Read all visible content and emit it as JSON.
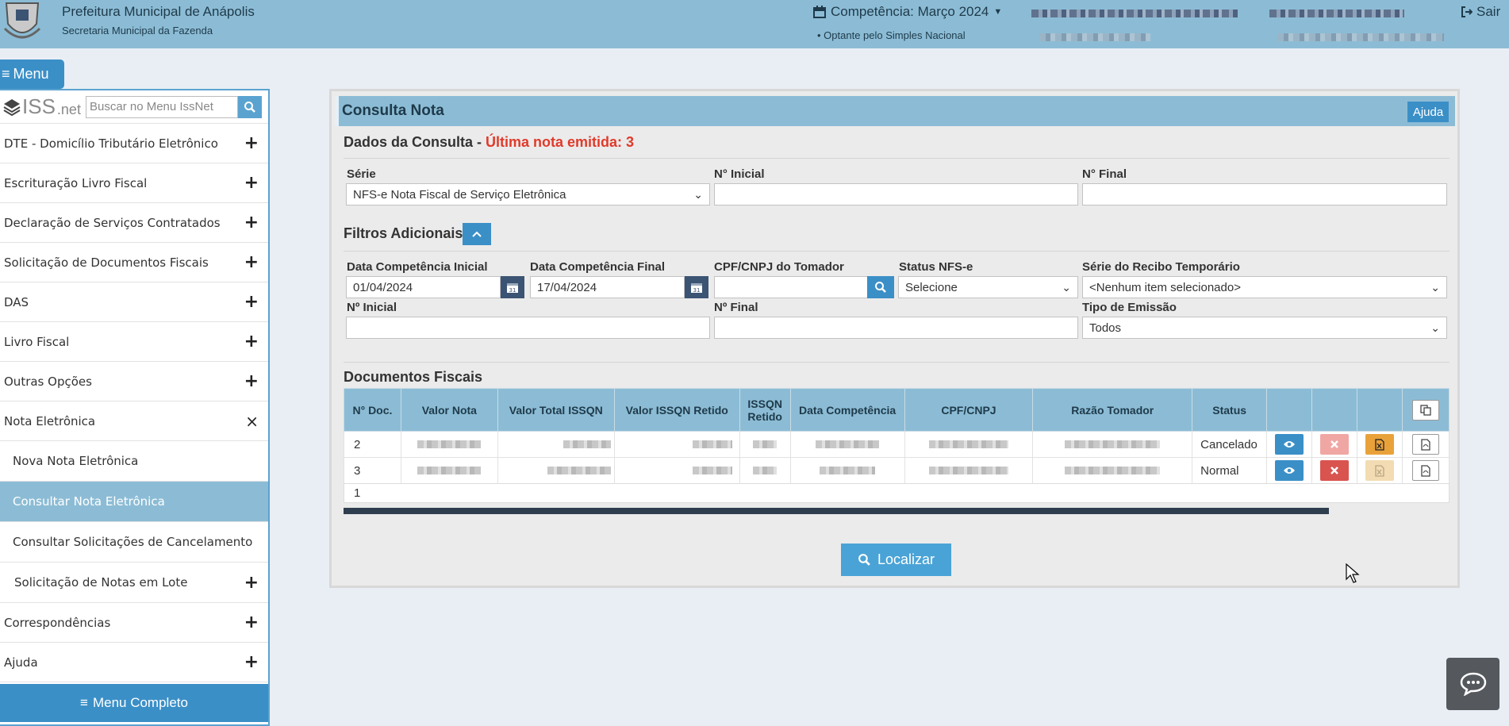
{
  "header": {
    "org_title": "Prefeitura Municipal de Anápolis",
    "org_subtitle": "Secretaria Municipal da Fazenda",
    "competencia": "Competência: Março 2024",
    "optante": "• Optante pelo Simples Nacional",
    "sair": "Sair"
  },
  "menu_button": "Menu",
  "sidebar": {
    "logo_text": "ISS",
    "logo_suffix": ".net",
    "search_placeholder": "Buscar no Menu IssNet",
    "items": [
      {
        "label": "DTE - Domicílio Tributário Eletrônico",
        "toggle": "+"
      },
      {
        "label": "Escrituração Livro Fiscal",
        "toggle": "+"
      },
      {
        "label": "Declaração de Serviços Contratados",
        "toggle": "+"
      },
      {
        "label": "Solicitação de Documentos Fiscais",
        "toggle": "+"
      },
      {
        "label": "DAS",
        "toggle": "+"
      },
      {
        "label": "Livro Fiscal",
        "toggle": "+"
      },
      {
        "label": "Outras Opções",
        "toggle": "+"
      },
      {
        "label": "Nota Eletrônica",
        "toggle": "×"
      },
      {
        "label": "Correspondências",
        "toggle": "+"
      },
      {
        "label": "Ajuda",
        "toggle": "+"
      }
    ],
    "subitems": [
      {
        "label": "Nova Nota Eletrônica"
      },
      {
        "label": "Consultar Nota Eletrônica"
      },
      {
        "label": "Consultar Solicitações de Cancelamento"
      },
      {
        "label": "Solicitação de Notas em Lote",
        "toggle": "+"
      }
    ],
    "menu_completo": "Menu Completo"
  },
  "panel": {
    "title": "Consulta Nota",
    "ajuda": "Ajuda",
    "dados_title": "Dados da Consulta -",
    "ultima_nota": "Última nota emitida: 3",
    "serie_label": "Série",
    "serie_value": "NFS-e Nota Fiscal de Serviço Eletrônica",
    "n_inicial_label": "N° Inicial",
    "n_final_label": "N° Final",
    "filtros_title": "Filtros Adicionais",
    "data_comp_inicial_label": "Data Competência Inicial",
    "data_comp_inicial_value": "01/04/2024",
    "data_comp_final_label": "Data Competência Final",
    "data_comp_final_value": "17/04/2024",
    "cpf_tomador_label": "CPF/CNPJ do Tomador",
    "status_label": "Status NFS-e",
    "status_value": "Selecione",
    "serie_recibo_label": "Série do Recibo Temporário",
    "serie_recibo_value": "<Nenhum item selecionado>",
    "n_inicial2_label": "Nº Inicial",
    "n_final2_label": "Nº Final",
    "tipo_emissao_label": "Tipo de Emissão",
    "tipo_emissao_value": "Todos",
    "documentos_title": "Documentos Fiscais",
    "localizar": "Localizar"
  },
  "table": {
    "headers": [
      "N° Doc.",
      "Valor Nota",
      "Valor  Total ISSQN",
      "Valor  ISSQN Retido",
      "ISSQN Retido",
      "Data Competência",
      "CPF/CNPJ",
      "Razão Tomador",
      "Status"
    ],
    "rows": [
      {
        "doc": "2",
        "status": "Cancelado"
      },
      {
        "doc": "3",
        "status": "Normal"
      }
    ],
    "page": "1"
  },
  "colors": {
    "header_bg": "#8cbcd5",
    "accent_blue": "#3b8fc7",
    "highlight_red": "#e03a2a",
    "calendar_btn": "#3c5473"
  }
}
